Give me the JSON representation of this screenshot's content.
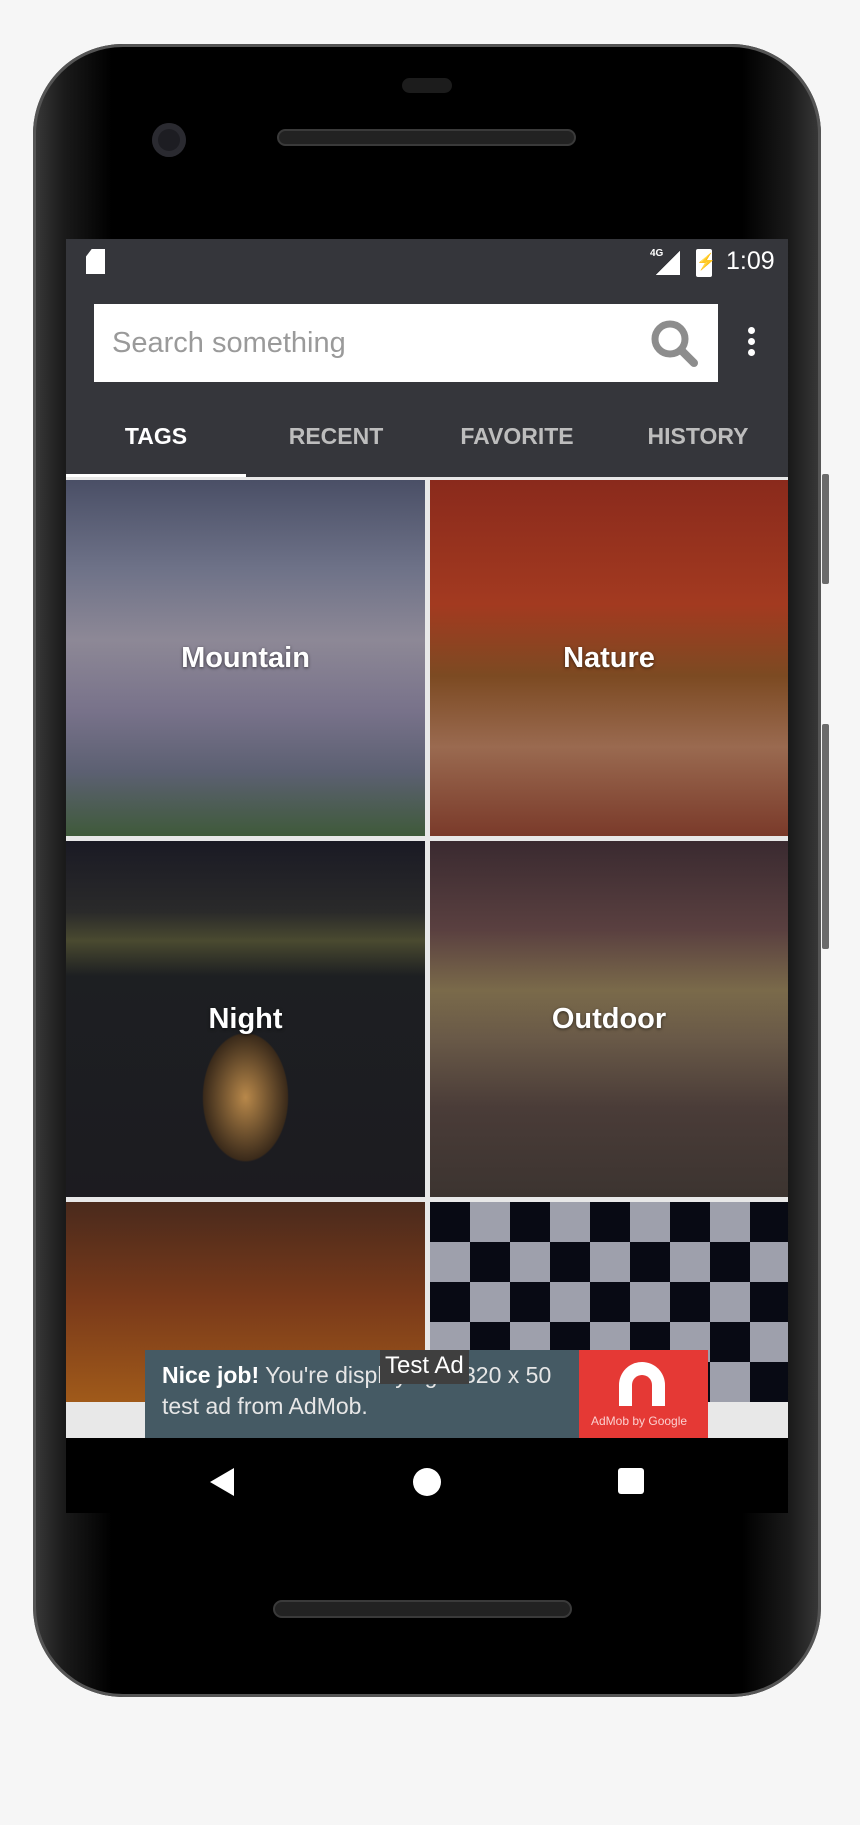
{
  "status_bar": {
    "network": "4G",
    "time": "1:09",
    "icons": [
      "sd-card-icon",
      "signal-icon",
      "battery-charging-icon"
    ]
  },
  "search": {
    "placeholder": "Search something",
    "value": ""
  },
  "tabs": [
    {
      "label": "TAGS",
      "active": true
    },
    {
      "label": "RECENT"
    },
    {
      "label": "FAVORITE"
    },
    {
      "label": "HISTORY"
    }
  ],
  "tiles": [
    {
      "label": "Mountain"
    },
    {
      "label": "Nature"
    },
    {
      "label": "Night"
    },
    {
      "label": "Outdoor"
    },
    {
      "label": ""
    },
    {
      "label": ""
    }
  ],
  "ad": {
    "badge": "Test Ad",
    "bold": "Nice job!",
    "text": " You're displaying a 320 x 50 test ad from AdMob.",
    "brand": "AdMob by Google",
    "brand_color": "#e53935"
  },
  "colors": {
    "appbar": "#35363b",
    "ad_bg": "#455a64"
  }
}
